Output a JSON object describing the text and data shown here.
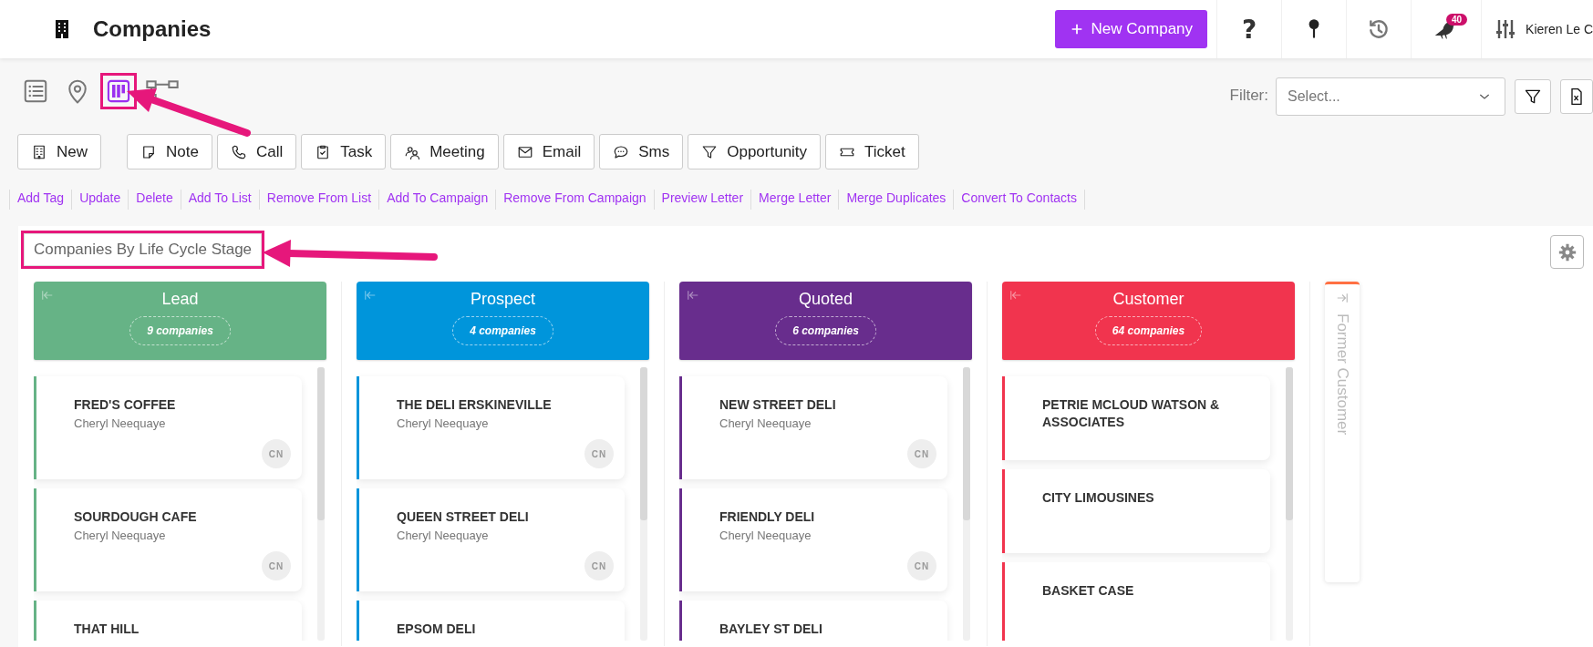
{
  "header": {
    "title": "Companies",
    "new_button": "New Company",
    "help_label": "?",
    "notification_count": "40",
    "user_name": "Kieren Le C"
  },
  "view_modes": [
    {
      "kind": "list",
      "selected": false,
      "highlighted": false
    },
    {
      "kind": "map",
      "selected": false,
      "highlighted": false
    },
    {
      "kind": "kanban",
      "selected": true,
      "highlighted": true
    },
    {
      "kind": "chart",
      "selected": false,
      "highlighted": false
    }
  ],
  "filter": {
    "label": "Filter:",
    "placeholder": "Select..."
  },
  "actions": [
    {
      "kind": "new",
      "label": "New"
    },
    {
      "kind": "note",
      "label": "Note"
    },
    {
      "kind": "call",
      "label": "Call"
    },
    {
      "kind": "task",
      "label": "Task"
    },
    {
      "kind": "meeting",
      "label": "Meeting"
    },
    {
      "kind": "email",
      "label": "Email"
    },
    {
      "kind": "sms",
      "label": "Sms"
    },
    {
      "kind": "opportunity",
      "label": "Opportunity"
    },
    {
      "kind": "ticket",
      "label": "Ticket"
    }
  ],
  "links": [
    "Add Tag",
    "Update",
    "Delete",
    "Add To List",
    "Remove From List",
    "Add To Campaign",
    "Remove From Campaign",
    "Preview Letter",
    "Merge Letter",
    "Merge Duplicates",
    "Convert To Contacts"
  ],
  "board": {
    "title": "Companies By Life Cycle Stage",
    "title_highlighted": true,
    "columns": [
      {
        "name": "Lead",
        "count": "9 companies",
        "color": "#66b386",
        "collapsed": false,
        "cards": [
          {
            "name": "FRED'S COFFEE",
            "owner": "Cheryl Neequaye",
            "initials": "CN"
          },
          {
            "name": "SOURDOUGH CAFE",
            "owner": "Cheryl Neequaye",
            "initials": "CN"
          },
          {
            "name": "THAT HILL"
          }
        ]
      },
      {
        "name": "Prospect",
        "count": "4 companies",
        "color": "#0095db",
        "collapsed": false,
        "cards": [
          {
            "name": "THE DELI ERSKINEVILLE",
            "owner": "Cheryl Neequaye",
            "initials": "CN"
          },
          {
            "name": "QUEEN STREET DELI",
            "owner": "Cheryl Neequaye",
            "initials": "CN"
          },
          {
            "name": "EPSOM DELI"
          }
        ]
      },
      {
        "name": "Quoted",
        "count": "6 companies",
        "color": "#682d8d",
        "collapsed": false,
        "cards": [
          {
            "name": "NEW STREET DELI",
            "owner": "Cheryl Neequaye",
            "initials": "CN"
          },
          {
            "name": "FRIENDLY DELI",
            "owner": "Cheryl Neequaye",
            "initials": "CN"
          },
          {
            "name": "BAYLEY ST DELI"
          }
        ]
      },
      {
        "name": "Customer",
        "count": "64 companies",
        "color": "#f1344e",
        "collapsed": false,
        "cards": [
          {
            "name": "PETRIE MCLOUD WATSON & ASSOCIATES"
          },
          {
            "name": "CITY LIMOUSINES"
          },
          {
            "name": "BASKET CASE"
          }
        ]
      },
      {
        "name": "Former Customer",
        "color": "#ff7043",
        "collapsed": true
      }
    ]
  }
}
